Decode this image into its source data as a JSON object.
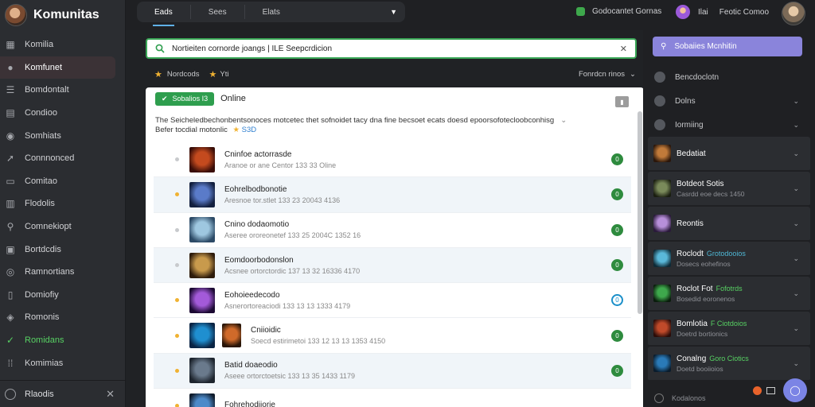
{
  "app": {
    "title": "Komunitas"
  },
  "sidebar": {
    "items": [
      {
        "label": "Komilia",
        "icon": "grid-icon"
      },
      {
        "label": "Komfunet",
        "icon": "avatar-icon",
        "active": true
      },
      {
        "label": "Bomdontalt",
        "icon": "list-icon"
      },
      {
        "label": "Condioo",
        "icon": "book-icon"
      },
      {
        "label": "Somhiats",
        "icon": "circle-icon"
      },
      {
        "label": "Connnonced",
        "icon": "rocket-icon"
      },
      {
        "label": "Comitao",
        "icon": "card-icon"
      },
      {
        "label": "Flodolis",
        "icon": "doc-icon"
      },
      {
        "label": "Comnekiopt",
        "icon": "link-icon"
      },
      {
        "label": "Bortdcdis",
        "icon": "square-icon"
      },
      {
        "label": "Ramnortians",
        "icon": "globe-icon"
      },
      {
        "label": "Domiofiy",
        "icon": "file-icon"
      },
      {
        "label": "Romonis",
        "icon": "shield-icon"
      },
      {
        "label": "Romidans",
        "icon": "check-circle-icon",
        "highlight": "#57d163"
      },
      {
        "label": "Komimias",
        "icon": "apps-icon"
      }
    ],
    "footer_label": "Rlaodis",
    "footer_close": "✕"
  },
  "topbar": {
    "tabs": [
      {
        "label": "Eads",
        "active": true
      },
      {
        "label": "Sees",
        "active": false
      },
      {
        "label": "Elats",
        "active": false
      }
    ],
    "status_text": "Godocantet Gornas",
    "user_short": "Ilai",
    "user_name": "Feotic Comoo"
  },
  "search": {
    "value": "Nortieiten cornorde joangs | ILE Seepcrdicion",
    "clear": "✕"
  },
  "filters": {
    "first": "Nordcods",
    "second": "Yti",
    "sort": "Fonrdcn rinos"
  },
  "panel": {
    "badge": "Sobalios I3",
    "online_label": "Online",
    "description_1": "The Seicheledbechonbentsonoces motcetec thet sofnoidet tacy dna fine becsoet ecats doesd epoorsofotecloobconhisg",
    "description_2": "Befer tocdial motonlic",
    "description_tag": "S3D",
    "rows": [
      {
        "title": "Cninfoe actorrasde",
        "sub": "Aranoe or ane Centor 133 33 Oline",
        "bullet": "gray",
        "thumb": [
          "#c44a1e",
          "#3a0e08"
        ],
        "status": "0",
        "status_color": "green"
      },
      {
        "title": "Eohrelbodbonotie",
        "sub": "Aresnoe tor.stlet 133 23 20043 4136",
        "bullet": "yellow",
        "thumb": [
          "#5a7bc9",
          "#13203f"
        ],
        "status": "0",
        "status_color": "green",
        "alt": true
      },
      {
        "title": "Cnino dodaomotio",
        "sub": "Aseree ororeonetef 133 25 2004C 1352 16",
        "bullet": "gray",
        "thumb": [
          "#9ec7e0",
          "#2c4a66"
        ],
        "status": "0",
        "status_color": "green"
      },
      {
        "title": "Eomdoorbodonslon",
        "sub": "Acsnee ortorctordic 137 13 32 16336 4170",
        "bullet": "gray",
        "thumb": [
          "#c89a4c",
          "#2e1c0c"
        ],
        "status": "0",
        "status_color": "green",
        "alt": true
      },
      {
        "title": "Eohoieedecodo",
        "sub": "Asnerortoreaciodi 133 13 13 1333 4179",
        "bullet": "yellow",
        "thumb": [
          "#a35ad9",
          "#1c0a33"
        ],
        "status": "0",
        "status_color": "blue"
      },
      {
        "title": "Cniioidic",
        "sub": "Soecd estirimetoi 133 12 13 13 1353 4150",
        "bullet": "yellow",
        "thumb": [
          "#1f8fd0",
          "#0a2444"
        ],
        "thumb2": [
          "#d06a2a",
          "#2a1608"
        ],
        "status": "0",
        "status_color": "green"
      },
      {
        "title": "Batid doaeodio",
        "sub": "Aseee ortorctoetsic 133 13 35 1433 1179",
        "bullet": "yellow",
        "thumb": [
          "#6a7a8c",
          "#1e252e"
        ],
        "status": "0",
        "status_color": "green",
        "alt": true
      },
      {
        "title": "Fohrehodiiorie",
        "sub": "",
        "bullet": "yellow",
        "thumb": [
          "#4c8ac9",
          "#101c2c"
        ],
        "status": "",
        "status_color": "green"
      }
    ]
  },
  "right": {
    "button_label": "Sobaiies Mcnhitin",
    "items": [
      {
        "label": "Bencdoclotn",
        "chevron": false
      },
      {
        "label": "Dolns",
        "chevron": true
      },
      {
        "label": "Iormiing",
        "chevron": true
      }
    ],
    "cards": [
      {
        "title": "Bedatiat",
        "tag": "",
        "sub": "",
        "colors": [
          "#c07a3a",
          "#2a160a"
        ]
      },
      {
        "title": "Botdeot Sotis",
        "tag": "",
        "sub": "Casrdd eoe decs 1450",
        "colors": [
          "#7a8a5a",
          "#1a1e10"
        ]
      },
      {
        "title": "Reontis",
        "tag": "",
        "sub": "",
        "colors": [
          "#b78fd9",
          "#2a1a3a"
        ]
      },
      {
        "title": "Roclodt",
        "tag": "Grotodooios",
        "sub": "Dosecs eohefinos",
        "colors": [
          "#5ab8d9",
          "#0e2a36"
        ],
        "tag_color": "#4fb7d4"
      },
      {
        "title": "Roclot Fot",
        "tag": "Fofotrds",
        "sub": "Bosedid eoronenos",
        "colors": [
          "#3ea84c",
          "#0a1c0c"
        ]
      },
      {
        "title": "Bomlotia",
        "tag": "F Ciotdoios",
        "sub": "Doetrd bortionics",
        "colors": [
          "#c04a2a",
          "#2a0c08"
        ]
      },
      {
        "title": "Conalng",
        "tag": "Goro Ciotics",
        "sub": "Doetd booiioios",
        "colors": [
          "#2a7ab8",
          "#0a1c2c"
        ]
      }
    ],
    "footer_label": "Kodalonos"
  }
}
